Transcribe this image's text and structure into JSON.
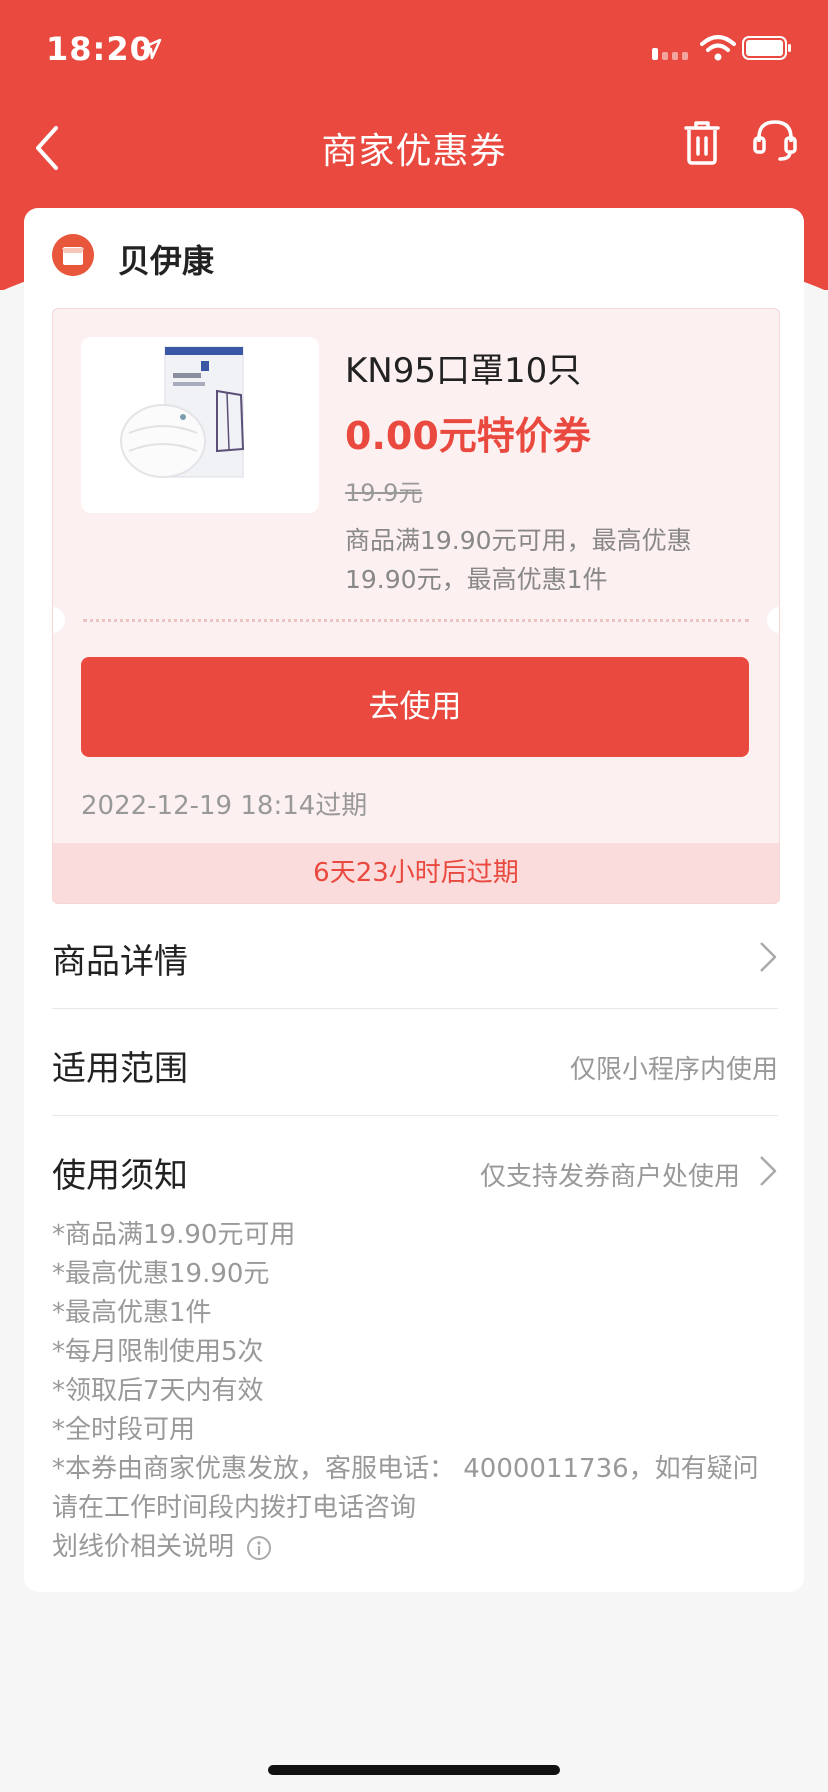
{
  "status_bar": {
    "time": "18:20"
  },
  "nav": {
    "title": "商家优惠券"
  },
  "shop": {
    "name": "贝伊康"
  },
  "coupon": {
    "product_title": "KN95口罩10只",
    "price_label": "0.00元特价券",
    "original_price": "19.9元",
    "rule_text": "商品满19.90元可用，最高优惠19.90元，最高优惠1件",
    "use_button": "去使用",
    "expire_date": "2022-12-19 18:14过期",
    "countdown": "6天23小时后过期"
  },
  "rows": {
    "product_detail": {
      "label": "商品详情"
    },
    "scope": {
      "label": "适用范围",
      "value": "仅限小程序内使用"
    },
    "notice": {
      "label": "使用须知",
      "value": "仅支持发券商户处使用"
    }
  },
  "notes": [
    "*商品满19.90元可用",
    "*最高优惠19.90元",
    "*最高优惠1件",
    "*每月限制使用5次",
    "*领取后7天内有效",
    "*全时段可用",
    "*本券由商家优惠发放，客服电话： 4000011736，如有疑问",
    "请在工作时间段内拨打电话咨询"
  ],
  "price_note": "划线价相关说明",
  "colors": {
    "accent": "#e9493e",
    "coupon_bg": "#fdf0f0"
  },
  "icons": [
    "location-arrow-icon",
    "signal-icon",
    "wifi-icon",
    "battery-icon",
    "back-icon",
    "trash-icon",
    "customer-service-icon",
    "shop-icon",
    "chevron-right-icon",
    "info-icon"
  ]
}
